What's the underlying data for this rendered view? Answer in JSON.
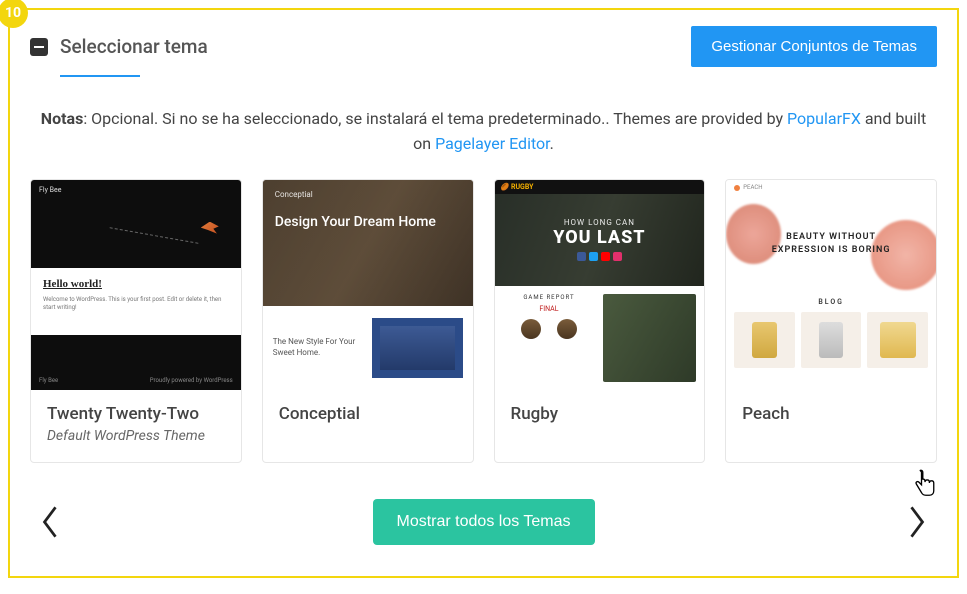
{
  "badge_number": "10",
  "header": {
    "title": "Seleccionar tema",
    "manage_button": "Gestionar Conjuntos de Temas"
  },
  "notes": {
    "label": "Notas",
    "text_before": ": Opcional. Si no se ha seleccionado, se instalará el tema predeterminado.. Themes are provided by ",
    "link1": "PopularFX",
    "text_mid": " and built on ",
    "link2": "Pagelayer Editor",
    "text_after": "."
  },
  "themes": [
    {
      "name": "Twenty Twenty-Two",
      "subtitle": "Default WordPress Theme",
      "preview": {
        "brand": "Fly Bee",
        "headline": "Hello world!",
        "sub": "Welcome to WordPress. This is your first post. Edit or delete it, then start writing!",
        "footer_left": "Fly Bee",
        "footer_right": "Proudly powered by WordPress"
      }
    },
    {
      "name": "Conceptial",
      "preview": {
        "brand": "Conceptial",
        "tagline": "Design Your Dream Home",
        "lower_text": "The New Style For Your Sweet Home."
      }
    },
    {
      "name": "Rugby",
      "preview": {
        "logo": "🏉 RUGBY",
        "line1": "HOW LONG CAN",
        "line2": "YOU LAST",
        "game_report": "GAME REPORT",
        "final": "FINAL"
      }
    },
    {
      "name": "Peach",
      "preview": {
        "brand": "PEACH",
        "headline1": "BEAUTY WITHOUT",
        "headline2": "EXPRESSION IS BORING",
        "blog_label": "BLOG"
      }
    }
  ],
  "footer": {
    "show_all": "Mostrar todos los Temas"
  },
  "colors": {
    "accent_blue": "#2196f3",
    "accent_teal": "#2bc4a0",
    "highlight_border": "#f3d60e"
  }
}
